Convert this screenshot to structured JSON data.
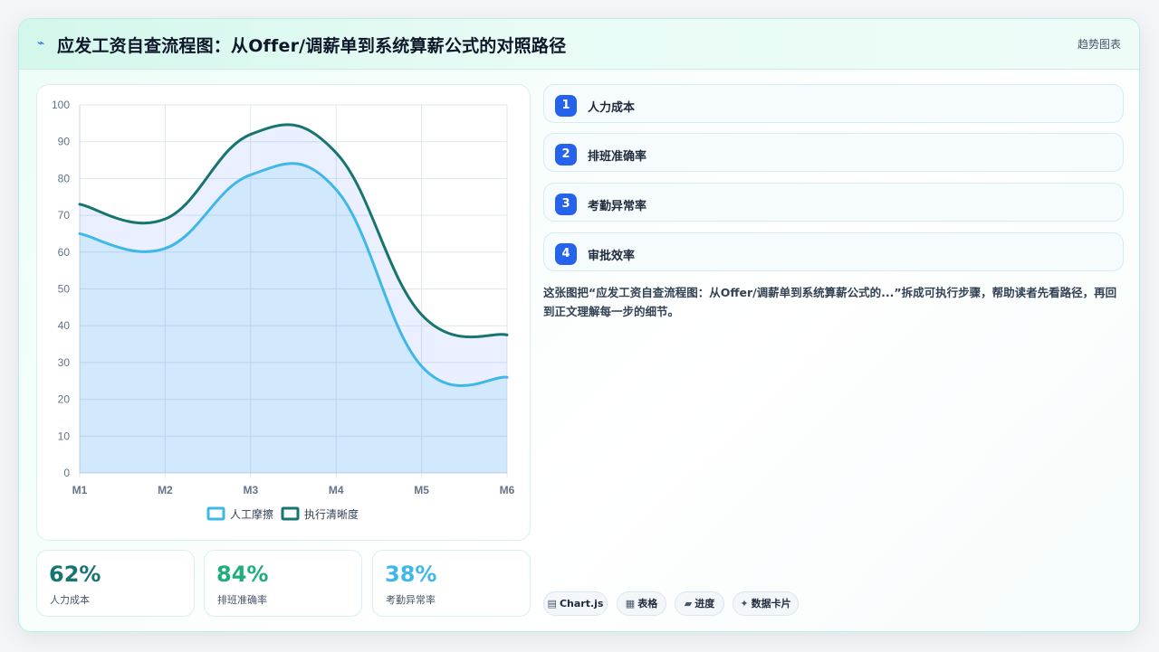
{
  "header": {
    "icon": "bolt-icon",
    "title": "应发工资自查流程图：从Offer/调薪单到系统算薪公式的对照路径",
    "tag": "趋势图表"
  },
  "chart_data": {
    "type": "area",
    "categories": [
      "M1",
      "M2",
      "M3",
      "M4",
      "M5",
      "M6"
    ],
    "series": [
      {
        "name": "人工摩擦",
        "values": [
          65,
          61,
          81,
          77,
          29,
          26
        ],
        "color": "#3fb8e8"
      },
      {
        "name": "执行清晰度",
        "values": [
          73,
          69,
          92,
          87,
          43,
          37.5
        ],
        "color": "#177570"
      }
    ],
    "ylim": [
      0,
      100
    ],
    "yticks": [
      "0",
      "10",
      "20",
      "30",
      "40",
      "50",
      "60",
      "70",
      "80",
      "90",
      "100"
    ],
    "grid": true,
    "legend": "bottom"
  },
  "stats": [
    {
      "value": "62%",
      "label": "人力成本",
      "color": "#177570"
    },
    {
      "value": "84%",
      "label": "排班准确率",
      "color": "#1fae7c"
    },
    {
      "value": "38%",
      "label": "考勤异常率",
      "color": "#3fb8e8"
    }
  ],
  "steps": [
    {
      "num": "1",
      "label": "人力成本"
    },
    {
      "num": "2",
      "label": "排班准确率"
    },
    {
      "num": "3",
      "label": "考勤异常率"
    },
    {
      "num": "4",
      "label": "审批效率"
    }
  ],
  "description": "这张图把“应发工资自查流程图：从Offer/调薪单到系统算薪公式的...”拆成可执行步骤，帮助读者先看路径，再回到正文理解每一步的细节。",
  "chips": [
    {
      "icon": "▤",
      "label": "Chart.js"
    },
    {
      "icon": "▦",
      "label": "表格"
    },
    {
      "icon": "▰",
      "label": "进度"
    },
    {
      "icon": "✦",
      "label": "数据卡片"
    }
  ]
}
